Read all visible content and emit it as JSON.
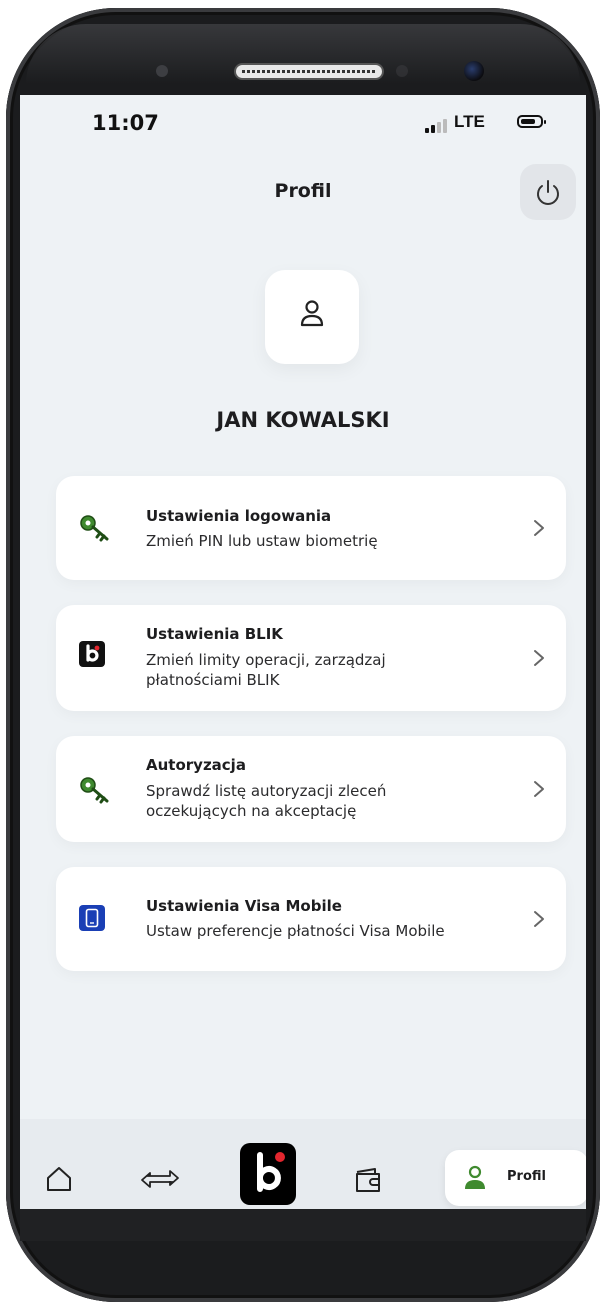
{
  "status_bar": {
    "time": "11:07",
    "network": "LTE"
  },
  "header": {
    "title": "Profil",
    "power_icon": "power-icon"
  },
  "profile": {
    "name": "JAN KOWALSKI",
    "avatar_icon": "user-icon"
  },
  "menu": [
    {
      "title": "Ustawienia logowania",
      "desc": "Zmień PIN lub ustaw biometrię",
      "icon": "key-icon"
    },
    {
      "title": "Ustawienia BLIK",
      "desc": "Zmień limity operacji, zarządzaj płatnościami BLIK",
      "icon": "blik-icon"
    },
    {
      "title": "Autoryzacja",
      "desc": "Sprawdź listę autoryzacji zleceń oczekujących na akceptację",
      "icon": "key-icon"
    },
    {
      "title": "Ustawienia Visa Mobile",
      "desc": "Ustaw preferencje płatności Visa Mobile",
      "icon": "visa-mobile-icon"
    }
  ],
  "tabbar": {
    "items": [
      "home-icon",
      "transfers-icon",
      "blik-icon",
      "wallet-icon",
      "user-icon"
    ],
    "active_label": "Profil"
  },
  "colors": {
    "key_green": "#3f8a2f",
    "blik_red": "#e3262e",
    "visa_blue": "#1a3fb5",
    "background": "#eef2f5"
  }
}
